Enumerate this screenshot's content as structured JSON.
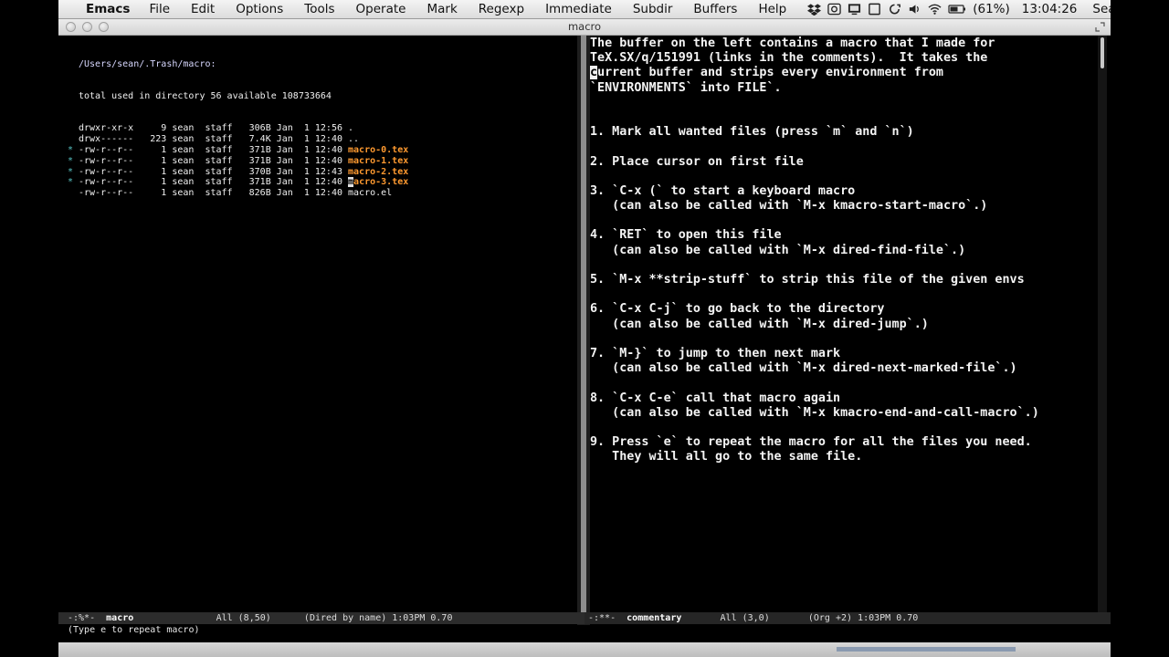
{
  "menubar": {
    "app_name": "Emacs",
    "menus": [
      "File",
      "Edit",
      "Options",
      "Tools",
      "Operate",
      "Mark",
      "Regexp",
      "Immediate",
      "Subdir",
      "Buffers",
      "Help"
    ],
    "battery": "(61%)",
    "clock": "13:04:26",
    "user": "Sean Allred",
    "status_icons": [
      "dropbox-icon",
      "screen-recorder-icon",
      "display-icon",
      "square-icon",
      "sync-icon",
      "volume-icon",
      "wifi-icon",
      "battery-icon",
      "spotlight-icon"
    ]
  },
  "window": {
    "title": "macro"
  },
  "dired": {
    "header": "/Users/sean/.Trash/macro:",
    "summary": "total used in directory 56 available 108733664",
    "rows": [
      {
        "marked": false,
        "perms": "drwxr-xr-x",
        "links": "9",
        "owner": "sean",
        "group": "staff",
        "size": "306B",
        "date": "Jan  1 12:56",
        "name": "."
      },
      {
        "marked": false,
        "perms": "drwx------",
        "links": "223",
        "owner": "sean",
        "group": "staff",
        "size": "7.4K",
        "date": "Jan  1 12:40",
        "name": ".."
      },
      {
        "marked": true,
        "perms": "-rw-r--r--",
        "links": "1",
        "owner": "sean",
        "group": "staff",
        "size": "371B",
        "date": "Jan  1 12:40",
        "name": "macro-0.tex"
      },
      {
        "marked": true,
        "perms": "-rw-r--r--",
        "links": "1",
        "owner": "sean",
        "group": "staff",
        "size": "371B",
        "date": "Jan  1 12:40",
        "name": "macro-1.tex"
      },
      {
        "marked": true,
        "perms": "-rw-r--r--",
        "links": "1",
        "owner": "sean",
        "group": "staff",
        "size": "370B",
        "date": "Jan  1 12:43",
        "name": "macro-2.tex"
      },
      {
        "marked": true,
        "perms": "-rw-r--r--",
        "links": "1",
        "owner": "sean",
        "group": "staff",
        "size": "371B",
        "date": "Jan  1 12:40",
        "name": "macro-3.tex"
      },
      {
        "marked": false,
        "perms": "-rw-r--r--",
        "links": "1",
        "owner": "sean",
        "group": "staff",
        "size": "826B",
        "date": "Jan  1 12:40",
        "name": "macro.el"
      }
    ]
  },
  "commentary": {
    "lines": [
      "The buffer on the left contains a macro that I made for",
      "TeX.SX/q/151991 (links in the comments).  It takes the",
      "current buffer and strips every environment from",
      "`ENVIRONMENTS` into FILE`.",
      "",
      "",
      "1. Mark all wanted files (press `m` and `n`)",
      "",
      "2. Place cursor on first file",
      "",
      "3. `C-x (` to start a keyboard macro",
      "   (can also be called with `M-x kmacro-start-macro`.)",
      "",
      "4. `RET` to open this file",
      "   (can also be called with `M-x dired-find-file`.)",
      "",
      "5. `M-x **strip-stuff` to strip this file of the given envs",
      "",
      "6. `C-x C-j` to go back to the directory",
      "   (can also be called with `M-x dired-jump`.)",
      "",
      "7. `M-}` to jump to then next mark",
      "   (can also be called with `M-x dired-next-marked-file`.)",
      "",
      "8. `C-x C-e` call that macro again",
      "   (can also be called with `M-x kmacro-end-and-call-macro`.)",
      "",
      "9. Press `e` to repeat the macro for all the files you need.",
      "   They will all go to the same file."
    ]
  },
  "modeline_left": {
    "status": "-:%*-",
    "buffer": "macro",
    "position": "All (8,50)",
    "mode": "(Dired by name) 1:03PM 0.70"
  },
  "modeline_right": {
    "status": "-:**-",
    "buffer": "commentary",
    "position": "All (3,0)",
    "mode": "(Org +2) 1:03PM 0.70"
  },
  "minibuffer": {
    "message": "(Type e to repeat macro)"
  }
}
